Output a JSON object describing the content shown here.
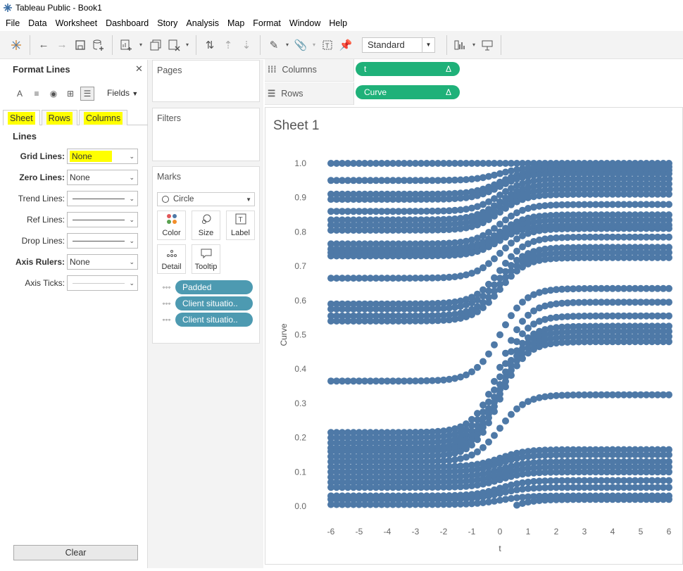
{
  "app": {
    "title": "Tableau Public - Book1"
  },
  "menu": [
    "File",
    "Data",
    "Worksheet",
    "Dashboard",
    "Story",
    "Analysis",
    "Map",
    "Format",
    "Window",
    "Help"
  ],
  "toolbar": {
    "fit_mode": "Standard"
  },
  "format_pane": {
    "title": "Format Lines",
    "fields_label": "Fields",
    "tabs": [
      "Sheet",
      "Rows",
      "Columns"
    ],
    "section": "Lines",
    "rows": [
      {
        "label": "Grid Lines:",
        "value": "None",
        "bold": true
      },
      {
        "label": "Zero Lines:",
        "value": "None",
        "bold": true
      },
      {
        "label": "Trend Lines:",
        "value": "",
        "bold": false
      },
      {
        "label": "Ref Lines:",
        "value": "",
        "bold": false
      },
      {
        "label": "Drop Lines:",
        "value": "",
        "bold": false
      },
      {
        "label": "Axis Rulers:",
        "value": "None",
        "bold": true
      },
      {
        "label": "Axis Ticks:",
        "value": "",
        "bold": false
      }
    ],
    "clear_label": "Clear"
  },
  "cards": {
    "pages": "Pages",
    "filters": "Filters",
    "marks": "Marks",
    "mark_type": "Circle",
    "buttons": [
      "Color",
      "Size",
      "Label",
      "Detail",
      "Tooltip"
    ],
    "pills": [
      "Padded",
      "Client situatio..",
      "Client situatio.."
    ]
  },
  "shelves": {
    "columns_label": "Columns",
    "rows_label": "Rows",
    "columns_pill": "t",
    "rows_pill": "Curve",
    "pill_symbol": "Δ"
  },
  "sheet": {
    "title": "Sheet 1"
  },
  "chart_data": {
    "type": "scatter",
    "xlabel": "t",
    "ylabel": "Curve",
    "x_ticks": [
      "-6",
      "-5",
      "-4",
      "-3",
      "-2",
      "-1",
      "0",
      "1",
      "2",
      "3",
      "4",
      "5",
      "6"
    ],
    "y_ticks": [
      "0.0",
      "0.1",
      "0.2",
      "0.3",
      "0.4",
      "0.5",
      "0.6",
      "0.7",
      "0.8",
      "0.9",
      "1.0"
    ],
    "xlim": [
      -6,
      6
    ],
    "ylim": [
      0,
      1
    ],
    "grid": false,
    "marker_color": "#4e79a7",
    "series": [
      {
        "start": 1.0,
        "end": 1.0
      },
      {
        "start": 0.95,
        "end": 0.99
      },
      {
        "start": 0.91,
        "end": 0.98
      },
      {
        "start": 0.895,
        "end": 0.97
      },
      {
        "start": 0.86,
        "end": 0.955
      },
      {
        "start": 0.835,
        "end": 0.94
      },
      {
        "start": 0.82,
        "end": 0.925
      },
      {
        "start": 0.805,
        "end": 0.91
      },
      {
        "start": 0.765,
        "end": 0.88
      },
      {
        "start": 0.75,
        "end": 0.85
      },
      {
        "start": 0.74,
        "end": 0.835
      },
      {
        "start": 0.73,
        "end": 0.82
      },
      {
        "start": 0.665,
        "end": 0.81
      },
      {
        "start": 0.59,
        "end": 0.785
      },
      {
        "start": 0.575,
        "end": 0.755
      },
      {
        "start": 0.555,
        "end": 0.74
      },
      {
        "start": 0.54,
        "end": 0.725
      },
      {
        "start": 0.365,
        "end": 0.635
      },
      {
        "start": 0.215,
        "end": 0.595
      },
      {
        "start": 0.2,
        "end": 0.555
      },
      {
        "start": 0.185,
        "end": 0.525
      },
      {
        "start": 0.17,
        "end": 0.51
      },
      {
        "start": 0.16,
        "end": 0.495
      },
      {
        "start": 0.145,
        "end": 0.48
      },
      {
        "start": 0.13,
        "end": 0.325
      },
      {
        "start": 0.115,
        "end": 0.165
      },
      {
        "start": 0.1,
        "end": 0.15
      },
      {
        "start": 0.085,
        "end": 0.13
      },
      {
        "start": 0.07,
        "end": 0.115
      },
      {
        "start": 0.055,
        "end": 0.1
      },
      {
        "start": 0.03,
        "end": 0.075
      },
      {
        "start": 0.02,
        "end": 0.055
      },
      {
        "start": 0.005,
        "end": 0.03
      },
      {
        "start": -0.06,
        "end": 0.02
      }
    ]
  }
}
